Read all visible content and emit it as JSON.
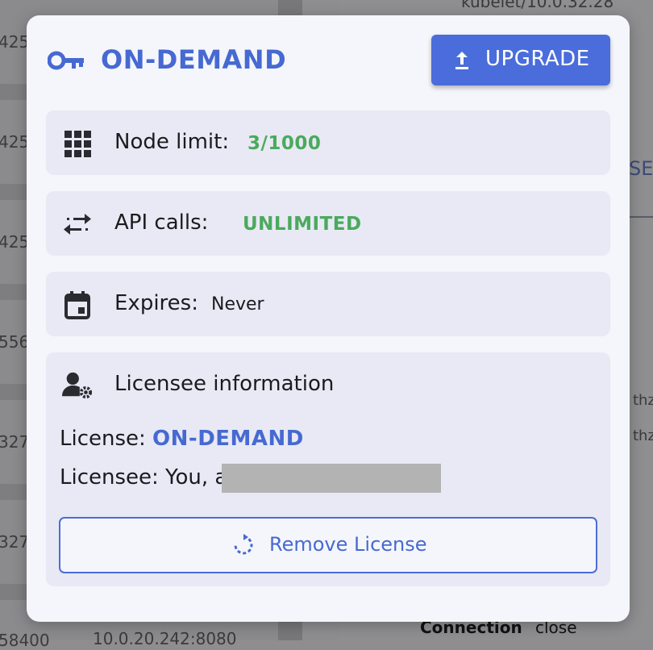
{
  "background": {
    "left_numbers": [
      "425",
      "425",
      "425",
      "556",
      "327",
      "327",
      "58400"
    ],
    "top_right_text": "kubelet/10.0.32.28",
    "right_fragments": [
      "SE",
      "thz",
      "thz"
    ],
    "bottom_text": "10.0.20.242:8080",
    "connection_label": "Connection",
    "connection_value": "close"
  },
  "modal": {
    "title": "ON-DEMAND",
    "title_icon": "key-icon",
    "upgrade_label": "UPGRADE",
    "upgrade_icon": "upload-arrow-icon",
    "rows": {
      "node_limit": {
        "icon": "grid-icon",
        "label": "Node limit:",
        "value": "3/1000"
      },
      "api_calls": {
        "icon": "swap-arrows-icon",
        "label": "API calls:",
        "value": "UNLIMITED"
      },
      "expires": {
        "icon": "calendar-icon",
        "label": "Expires:",
        "value": "Never"
      }
    },
    "licensee": {
      "icon": "user-gear-icon",
      "heading": "Licensee information",
      "license_label": "License:",
      "license_value": "ON-DEMAND",
      "licensee_label": "Licensee: You, a",
      "remove_label": "Remove License",
      "remove_icon": "refresh-icon"
    }
  },
  "colors": {
    "accent": "#4a6ddb",
    "accent_text": "#4669d2",
    "success": "#4aaa5d",
    "card_bg": "#e8e9f4",
    "modal_bg": "#f5f6fb"
  }
}
